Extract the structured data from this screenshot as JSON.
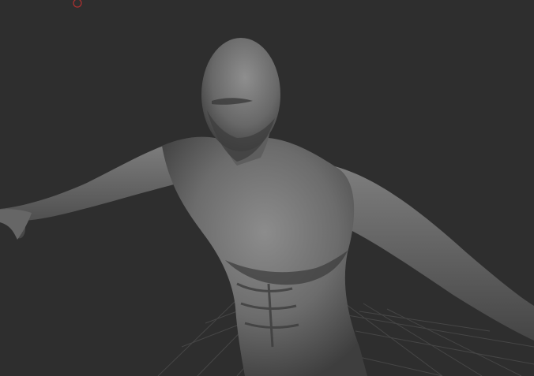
{
  "viewport": {
    "background_color": "#2e2e2e",
    "grid_color": "#4a4a4a",
    "model_color": "#6f6f6f",
    "model_highlight_color": "#8a8a8a",
    "model_shadow_color": "#2a2a2a",
    "marker_color": "#b03030",
    "marker_icon": "circle-marker-icon",
    "shading_mode_icon": "sculpt-mesh-icon"
  }
}
